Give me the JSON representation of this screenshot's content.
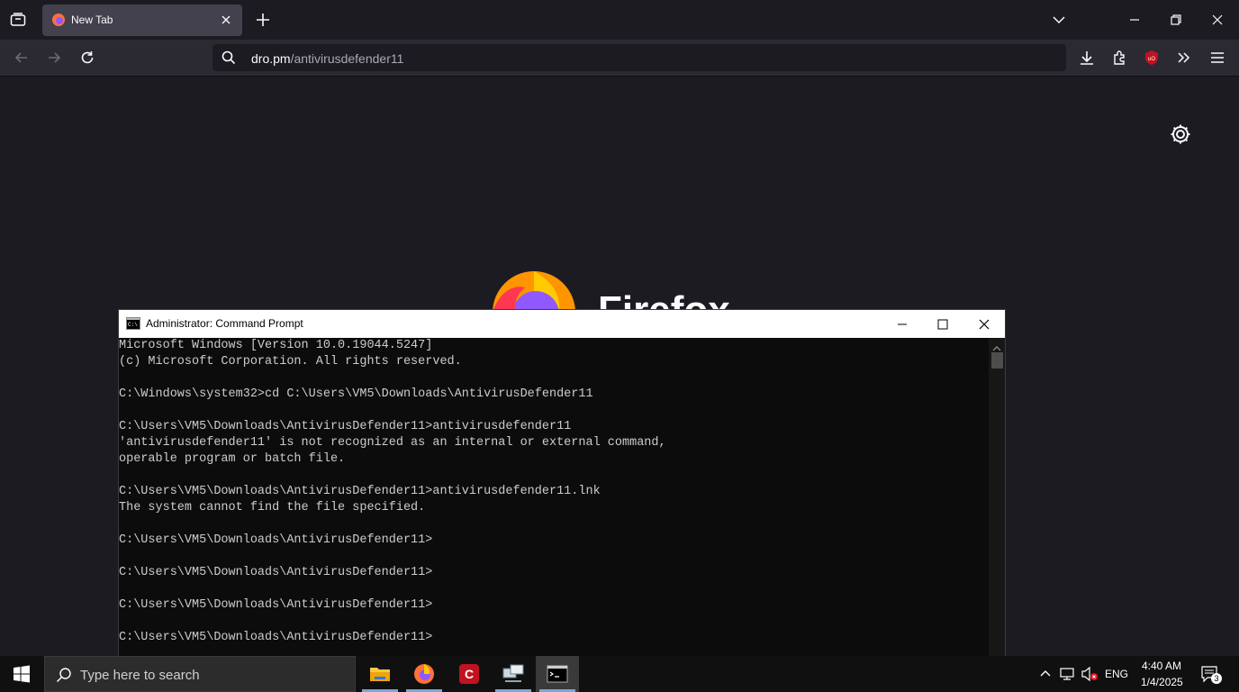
{
  "browser": {
    "tab_title": "New Tab",
    "url_host": "dro.pm",
    "url_path": "/antivirusdefender11",
    "logo_text": "Firefox"
  },
  "cmd": {
    "title": "Administrator: Command Prompt",
    "lines": [
      "Microsoft Windows [Version 10.0.19044.5247]",
      "(c) Microsoft Corporation. All rights reserved.",
      "",
      "C:\\Windows\\system32>cd C:\\Users\\VM5\\Downloads\\AntivirusDefender11",
      "",
      "C:\\Users\\VM5\\Downloads\\AntivirusDefender11>antivirusdefender11",
      "'antivirusdefender11' is not recognized as an internal or external command,",
      "operable program or batch file.",
      "",
      "C:\\Users\\VM5\\Downloads\\AntivirusDefender11>antivirusdefender11.lnk",
      "The system cannot find the file specified.",
      "",
      "C:\\Users\\VM5\\Downloads\\AntivirusDefender11>",
      "",
      "C:\\Users\\VM5\\Downloads\\AntivirusDefender11>",
      "",
      "C:\\Users\\VM5\\Downloads\\AntivirusDefender11>",
      "",
      "C:\\Users\\VM5\\Downloads\\AntivirusDefender11>"
    ]
  },
  "taskbar": {
    "search_placeholder": "Type here to search",
    "language": "ENG",
    "time": "4:40 AM",
    "date": "1/4/2025",
    "notification_count": "3"
  },
  "colors": {
    "firefox_orange": "#ff9500",
    "firefox_purple": "#9059ff",
    "ublock_red": "#c1121f"
  }
}
